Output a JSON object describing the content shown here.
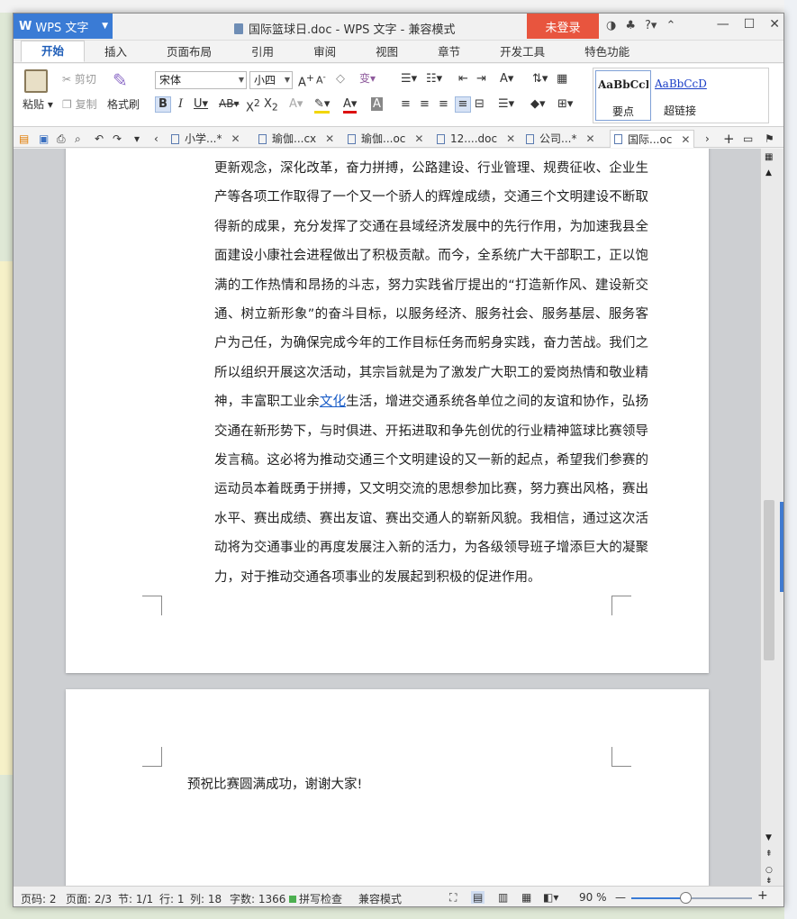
{
  "app": {
    "name": "WPS 文字",
    "logo_letter": "W",
    "doc_title": "国际篮球日.doc - WPS 文字 - 兼容模式",
    "login_label": "未登录",
    "help_label": "?"
  },
  "ribbon_tabs": [
    "开始",
    "插入",
    "页面布局",
    "引用",
    "审阅",
    "视图",
    "章节",
    "开发工具",
    "特色功能"
  ],
  "ribbon": {
    "paste": "粘贴",
    "cut": "剪切",
    "copy": "复制",
    "format_painter": "格式刷",
    "font_name": "宋体",
    "font_size": "小四",
    "style_normal_preview": "AaBbCcD",
    "style_normal_name": "要点",
    "style_link_preview": "AaBbCcD",
    "style_link_name": "超链接"
  },
  "doc_tabs": [
    "小学...",
    "瑜伽...cx",
    "瑜伽...oc",
    "12....doc",
    "公司...",
    "国际...oc"
  ],
  "document": {
    "page1_text_before_link": "更新观念，深化改革，奋力拼搏，公路建设、行业管理、规费征收、企业生产等各项工作取得了一个又一个骄人的辉煌成绩，交通三个文明建设不断取得新的成果，充分发挥了交通在县域经济发展中的先行作用，为加速我县全面建设小康社会进程做出了积极贡献。而今，全系统广大干部职工，正以饱满的工作热情和昂扬的斗志，努力实践省厅提出的“打造新作风、建设新交通、树立新形象”的奋斗目标，以服务经济、服务社会、服务基层、服务客户为己任，为确保完成今年的工作目标任务而躬身实践，奋力苦战。我们之所以组织开展这次活动，其宗旨就是为了激发广大职工的爱岗热情和敬业精神，丰富职工业余",
    "link_text": "文化",
    "page1_text_after_link": "生活，增进交通系统各单位之间的友谊和协作，弘扬交通在新形势下，与时俱进、开拓进取和争先创优的行业精神篮球比赛领导发言稿。这必将为推动交通三个文明建设的又一新的起点，希望我们参赛的运动员本着既勇于拼搏，又文明交流的思想参加比赛，努力赛出风格，赛出水平、赛出成绩、赛出友谊、赛出交通人的崭新风貌。我相信，通过这次活动将为交通事业的再度发展注入新的活力，为各级领导班子增添巨大的凝聚力，对于推动交通各项事业的发展起到积极的促进作用。",
    "page2_text": "预祝比赛圆满成功，谢谢大家!"
  },
  "status": {
    "page_no": "页码: 2",
    "pages": "页面: 2/3",
    "section": "节: 1/1",
    "row": "行: 1",
    "col": "列: 18",
    "words": "字数: 1366",
    "spellcheck": "拼写检查",
    "compat": "兼容模式",
    "zoom": "90 %"
  },
  "colors": {
    "accent": "#3a7bd5",
    "login": "#e8553e",
    "link": "#1a5dc7"
  }
}
